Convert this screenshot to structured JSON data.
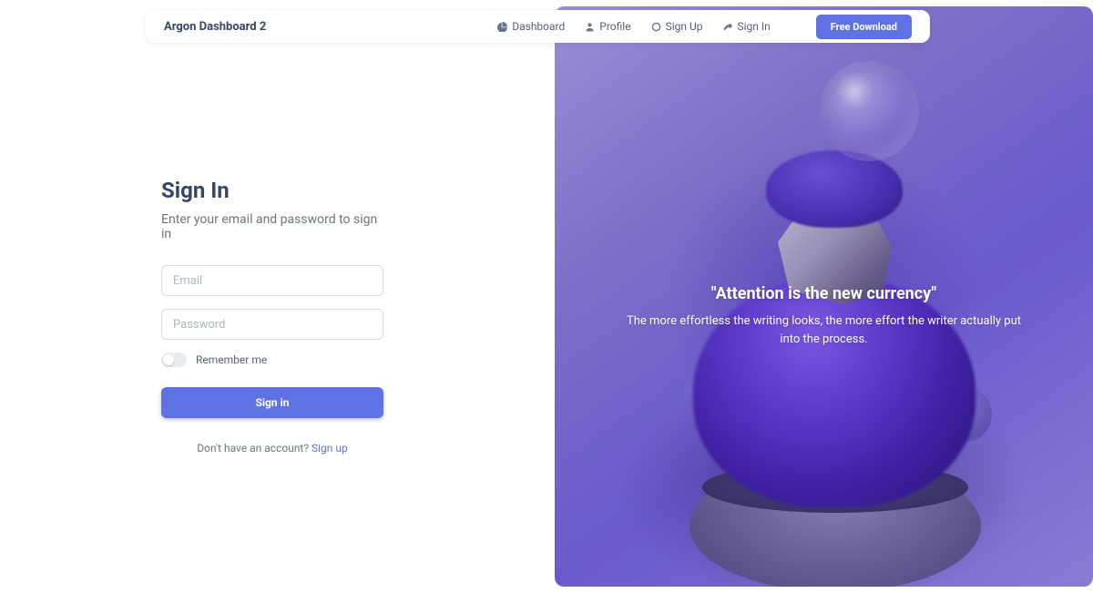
{
  "brand": "Argon Dashboard 2",
  "nav": {
    "dashboard": "Dashboard",
    "profile": "Profile",
    "signup": "Sign Up",
    "signin": "Sign In",
    "download": "Free Download"
  },
  "form": {
    "title": "Sign In",
    "subtitle": "Enter your email and password to sign in",
    "email_placeholder": "Email",
    "password_placeholder": "Password",
    "remember": "Remember me",
    "submit": "Sign in",
    "no_account": "Don't have an account? ",
    "signup_link": "Sign up"
  },
  "hero": {
    "quote": "\"Attention is the new currency\"",
    "sub": "The more effortless the writing looks, the more effort the writer actually put into the process."
  }
}
